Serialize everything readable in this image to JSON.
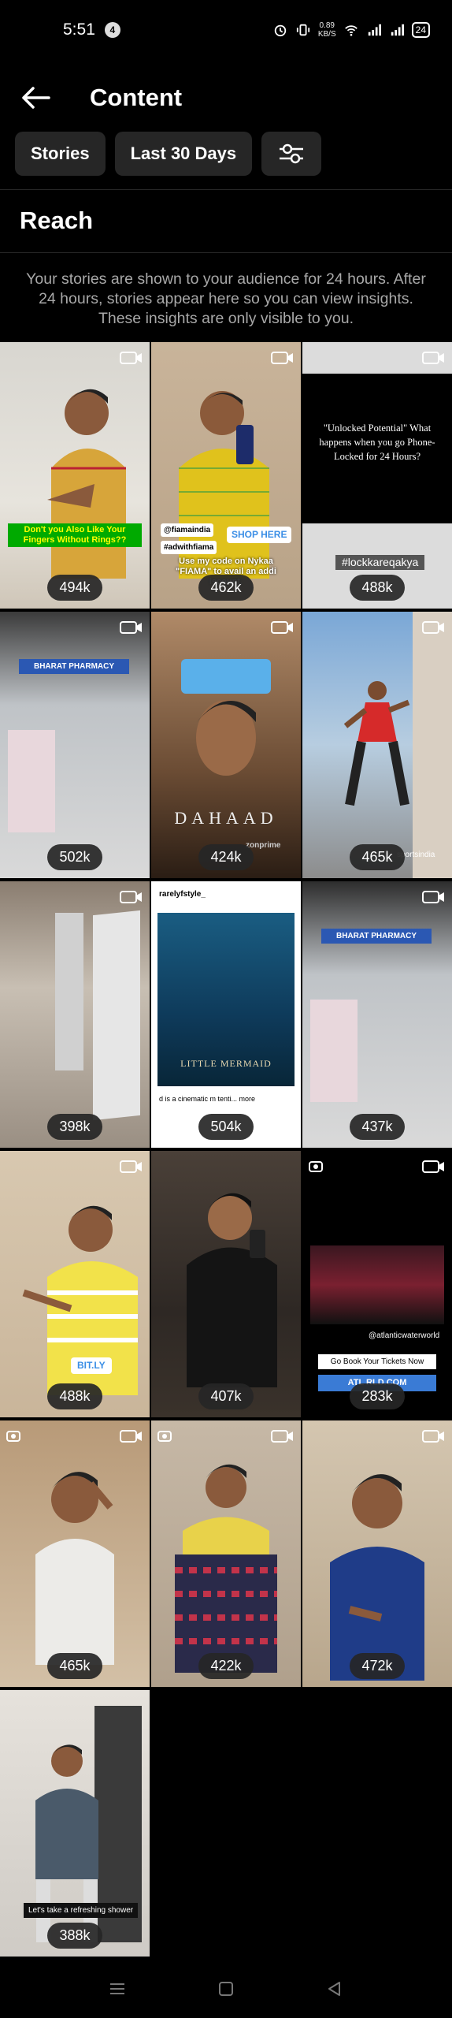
{
  "status_bar": {
    "time": "5:51",
    "notification_count": "4",
    "net_speed": "0.89",
    "net_unit": "KB/S",
    "battery": "24"
  },
  "header": {
    "title": "Content"
  },
  "filters": {
    "content_type": "Stories",
    "date_range": "Last 30 Days"
  },
  "section": {
    "title": "Reach",
    "info": "Your stories are shown to your audience for 24 hours. After 24 hours, stories appear here so you can view insights. These insights are only visible to you."
  },
  "stories": [
    {
      "reach": "494k",
      "caption": "Don't you Also Like Your Fingers Without Rings??"
    },
    {
      "reach": "462k",
      "caption": "Use my code on Nykaa \"FIAMA\" to avail an addi    iscount.",
      "tag1": "@fiamaindia",
      "tag2": "#adwithfiama",
      "link": "SHOP HERE"
    },
    {
      "reach": "488k",
      "caption": "\"Unlocked Potential\" What happens when you go Phone-Locked for 24 Hours?",
      "tag1": "#lockkareqakya"
    },
    {
      "reach": "502k",
      "caption": "BHARAT PHARMACY"
    },
    {
      "reach": "424k",
      "caption": "DAHAAD",
      "tag1": "zonprime"
    },
    {
      "reach": "465k",
      "caption": "",
      "tag1": "sportsindia"
    },
    {
      "reach": "398k",
      "caption": ""
    },
    {
      "reach": "504k",
      "caption": "LITTLE MERMAID",
      "tag1": "rarelyfstyle_",
      "tag2": "d is a cinematic m    tenti... more"
    },
    {
      "reach": "437k",
      "caption": "BHARAT PHARMACY"
    },
    {
      "reach": "488k",
      "caption": "",
      "link": "BIT.LY"
    },
    {
      "reach": "407k",
      "caption": ""
    },
    {
      "reach": "283k",
      "caption": "Go Book Your Tickets Now",
      "tag1": "@atlanticwaterworld",
      "link": "ATL     RLD.COM"
    },
    {
      "reach": "465k",
      "caption": ""
    },
    {
      "reach": "422k",
      "caption": ""
    },
    {
      "reach": "472k",
      "caption": ""
    },
    {
      "reach": "388k",
      "caption": "Let's take a refreshing shower"
    }
  ]
}
